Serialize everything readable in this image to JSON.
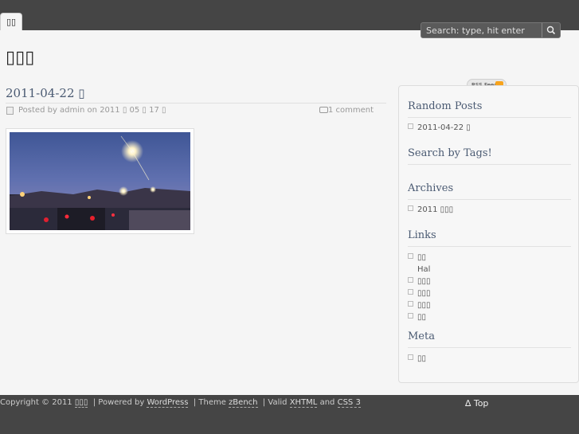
{
  "nav": {
    "tab_label": "▯▯"
  },
  "search": {
    "placeholder": "Search: type, hit enter"
  },
  "site": {
    "title": "▯▯▯"
  },
  "post": {
    "title": "2011-04-22 ▯",
    "meta_by": "Posted by admin on 2011 ▯ 05 ▯ 17 ▯",
    "comments": "1 comment"
  },
  "sidebar": {
    "rss_label": "RSS Feed",
    "random_title": "Random Posts",
    "random_items": [
      "2011-04-22 ▯"
    ],
    "tags_title": "Search by Tags!",
    "archives_title": "Archives",
    "archive_items": [
      "2011 ▯▯▯"
    ],
    "links_title": "Links",
    "link_items": [
      "▯▯",
      "Hal",
      "▯▯▯",
      "▯▯▯",
      "▯▯▯",
      "▯▯"
    ],
    "meta_title": "Meta",
    "meta_items": [
      "▯▯"
    ]
  },
  "footer": {
    "copyright": "Copyright © 2011",
    "site_name": "▯▯▯",
    "powered": "| Powered by",
    "wordpress": "WordPress",
    "theme": "| Theme",
    "zbench": "zBench",
    "valid": "| Valid",
    "xhtml": "XHTML",
    "and": "and",
    "css": "CSS 3",
    "top": "∆ Top"
  }
}
